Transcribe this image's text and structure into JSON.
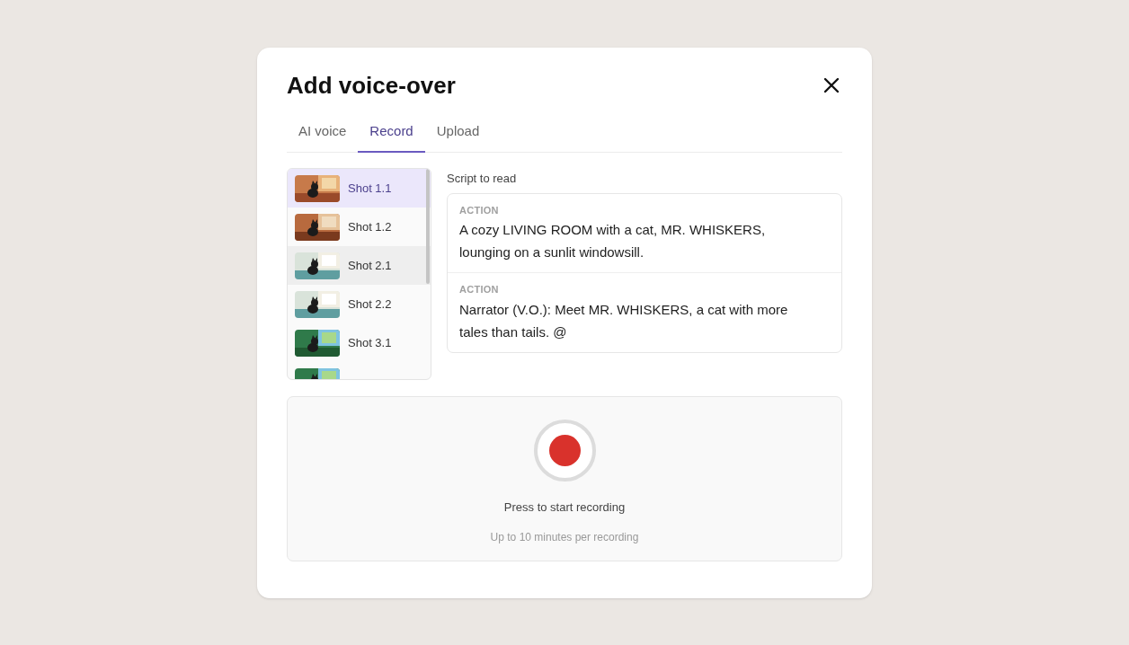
{
  "dialog": {
    "title": "Add voice-over"
  },
  "tabs": [
    {
      "label": "AI voice",
      "selected": false
    },
    {
      "label": "Record",
      "selected": true
    },
    {
      "label": "Upload",
      "selected": false
    }
  ],
  "shots": [
    {
      "label": "Shot 1.1",
      "selected": true,
      "hovered": false,
      "kind": "room"
    },
    {
      "label": "Shot 1.2",
      "selected": false,
      "hovered": false,
      "kind": "closeup"
    },
    {
      "label": "Shot 2.1",
      "selected": false,
      "hovered": true,
      "kind": "bright"
    },
    {
      "label": "Shot 2.2",
      "selected": false,
      "hovered": false,
      "kind": "bright"
    },
    {
      "label": "Shot 3.1",
      "selected": false,
      "hovered": false,
      "kind": "forest"
    },
    {
      "selected": false,
      "hovered": false,
      "kind": "forest"
    }
  ],
  "script": {
    "label": "Script to read",
    "blocks": [
      {
        "tag": "ACTION",
        "text": "A cozy LIVING ROOM with a cat, MR. WHISKERS, lounging on a sunlit windowsill."
      },
      {
        "tag": "ACTION",
        "text": "Narrator (V.O.): Meet MR. WHISKERS, a cat with more tales than tails. @"
      }
    ]
  },
  "recorder": {
    "prompt": "Press to start recording",
    "hint": "Up to 10 minutes per recording"
  }
}
